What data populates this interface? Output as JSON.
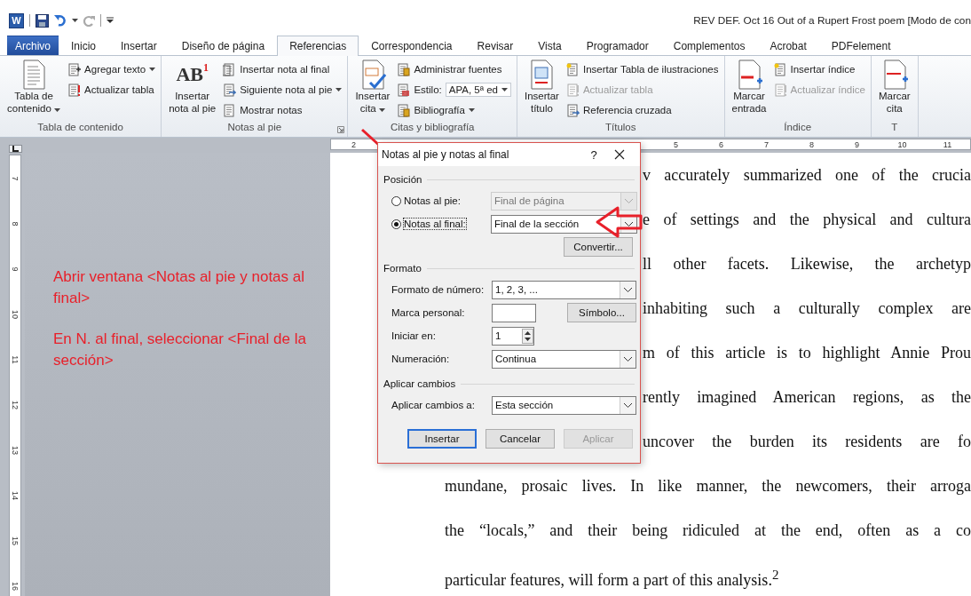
{
  "title_bar": {
    "app_letter": "W",
    "title": "REV DEF. Oct 16 Out of a Rupert Frost poem [Modo de con"
  },
  "tabs": [
    {
      "label": "Archivo",
      "kind": "file",
      "selected": false
    },
    {
      "label": "Inicio",
      "kind": "tab",
      "selected": false
    },
    {
      "label": "Insertar",
      "kind": "tab",
      "selected": false
    },
    {
      "label": "Diseño de página",
      "kind": "tab",
      "selected": false
    },
    {
      "label": "Referencias",
      "kind": "tab",
      "selected": true
    },
    {
      "label": "Correspondencia",
      "kind": "tab",
      "selected": false
    },
    {
      "label": "Revisar",
      "kind": "tab",
      "selected": false
    },
    {
      "label": "Vista",
      "kind": "tab",
      "selected": false
    },
    {
      "label": "Programador",
      "kind": "tab",
      "selected": false
    },
    {
      "label": "Complementos",
      "kind": "tab",
      "selected": false
    },
    {
      "label": "Acrobat",
      "kind": "tab",
      "selected": false
    },
    {
      "label": "PDFelement",
      "kind": "tab",
      "selected": false
    }
  ],
  "ribbon": {
    "groups": [
      {
        "label": "Tabla de contenido",
        "launcher": false,
        "large": [
          {
            "label": "Tabla de\ncontenido",
            "dropdown": true
          }
        ],
        "small": [
          {
            "kind": "button",
            "label": "Agregar texto",
            "dropdown": true,
            "disabled": false
          },
          {
            "kind": "button",
            "label": "Actualizar tabla",
            "dropdown": false,
            "disabled": false
          }
        ]
      },
      {
        "label": "Notas al pie",
        "launcher": true,
        "large": [
          {
            "label": "Insertar\nnota al pie",
            "dropdown": false,
            "icon_text": "AB",
            "icon_mark": "1"
          }
        ],
        "small": [
          {
            "kind": "button",
            "label": "Insertar nota al final",
            "dropdown": false,
            "disabled": false
          },
          {
            "kind": "button",
            "label": "Siguiente nota al pie",
            "dropdown": true,
            "disabled": false
          },
          {
            "kind": "button",
            "label": "Mostrar notas",
            "dropdown": false,
            "disabled": false
          }
        ]
      },
      {
        "label": "Citas y bibliografía",
        "launcher": false,
        "large": [
          {
            "label": "Insertar\ncita",
            "dropdown": true
          }
        ],
        "small": [
          {
            "kind": "button",
            "label": "Administrar fuentes",
            "dropdown": false,
            "disabled": false
          },
          {
            "kind": "style",
            "label": "Estilo:",
            "value": "APA, 5ª ed",
            "dropdown": true,
            "disabled": false
          },
          {
            "kind": "button",
            "label": "Bibliografía",
            "dropdown": true,
            "disabled": false
          }
        ]
      },
      {
        "label": "Títulos",
        "launcher": false,
        "large": [
          {
            "label": "Insertar\ntítulo",
            "dropdown": false
          }
        ],
        "small": [
          {
            "kind": "button",
            "label": "Insertar Tabla de ilustraciones",
            "dropdown": false,
            "disabled": false
          },
          {
            "kind": "button",
            "label": "Actualizar tabla",
            "dropdown": false,
            "disabled": true
          },
          {
            "kind": "button",
            "label": "Referencia cruzada",
            "dropdown": false,
            "disabled": false
          }
        ]
      },
      {
        "label": "Índice",
        "launcher": false,
        "large": [
          {
            "label": "Marcar\nentrada",
            "dropdown": false
          }
        ],
        "small": [
          {
            "kind": "button",
            "label": "Insertar índice",
            "dropdown": false,
            "disabled": false
          },
          {
            "kind": "button",
            "label": "Actualizar índice",
            "dropdown": false,
            "disabled": true
          }
        ]
      },
      {
        "label": "T",
        "launcher": false,
        "large": [
          {
            "label": "Marcar\ncita",
            "dropdown": false
          }
        ]
      }
    ]
  },
  "ruler": {
    "left_labels": [
      "2"
    ],
    "right_labels": [
      "5",
      "6",
      "7",
      "8",
      "9",
      "10",
      "11"
    ],
    "vertical_labels": [
      "7",
      "8",
      "9",
      "10",
      "11",
      "12",
      "13",
      "14",
      "15",
      "16"
    ]
  },
  "annotation": [
    "Abrir ventana <Notas al pie y notas al final>",
    "En N. al final, seleccionar <Final de la sección>"
  ],
  "document_lines": [
    {
      "text": "v accurately summarized one of the crucia",
      "covered": true
    },
    {
      "text": "e of settings and the physical and cultura",
      "covered": true
    },
    {
      "text": "ll other facets. Likewise, the archetyp",
      "covered": true
    },
    {
      "text": "inhabiting such a culturally complex are",
      "covered": true
    },
    {
      "text": "m of this article is to highlight Annie Prou",
      "covered": true
    },
    {
      "text": "rently imagined American regions, as the",
      "covered": true
    },
    {
      "text": "uncover the burden its residents are fo",
      "covered": true
    },
    {
      "text": "mundane, prosaic lives. In like manner, the newcomers, their arroga",
      "covered": false
    },
    {
      "text": "the “locals,” and their being ridiculed at the end, often as a co",
      "covered": false
    },
    {
      "text": "particular features, will form a part of this analysis.$^{2}$",
      "covered": false
    }
  ],
  "dialog": {
    "title": "Notas al pie y notas al final",
    "help": "?",
    "position": {
      "heading": "Posición",
      "options": [
        {
          "label": "Notas al pie:",
          "selected": false,
          "focused": false,
          "value": "Final de página",
          "disabled": true
        },
        {
          "label": "Notas al final:",
          "selected": true,
          "focused": true,
          "value": "Final de la sección",
          "disabled": false
        }
      ],
      "convert_button": "Convertir..."
    },
    "format": {
      "heading": "Formato",
      "number_format": {
        "label": "Formato de número:",
        "value": "1, 2, 3, ..."
      },
      "custom_mark": {
        "label": "Marca personal:",
        "button": "Símbolo..."
      },
      "start_at": {
        "label": "Iniciar en:",
        "value": "1"
      },
      "numbering": {
        "label": "Numeración:",
        "value": "Continua"
      }
    },
    "apply": {
      "heading": "Aplicar cambios",
      "apply_to": {
        "label": "Aplicar cambios a:",
        "value": "Esta sección"
      }
    },
    "buttons": [
      {
        "label": "Insertar",
        "default": true,
        "disabled": false
      },
      {
        "label": "Cancelar",
        "default": false,
        "disabled": false
      },
      {
        "label": "Aplicar",
        "default": false,
        "disabled": true
      }
    ]
  }
}
